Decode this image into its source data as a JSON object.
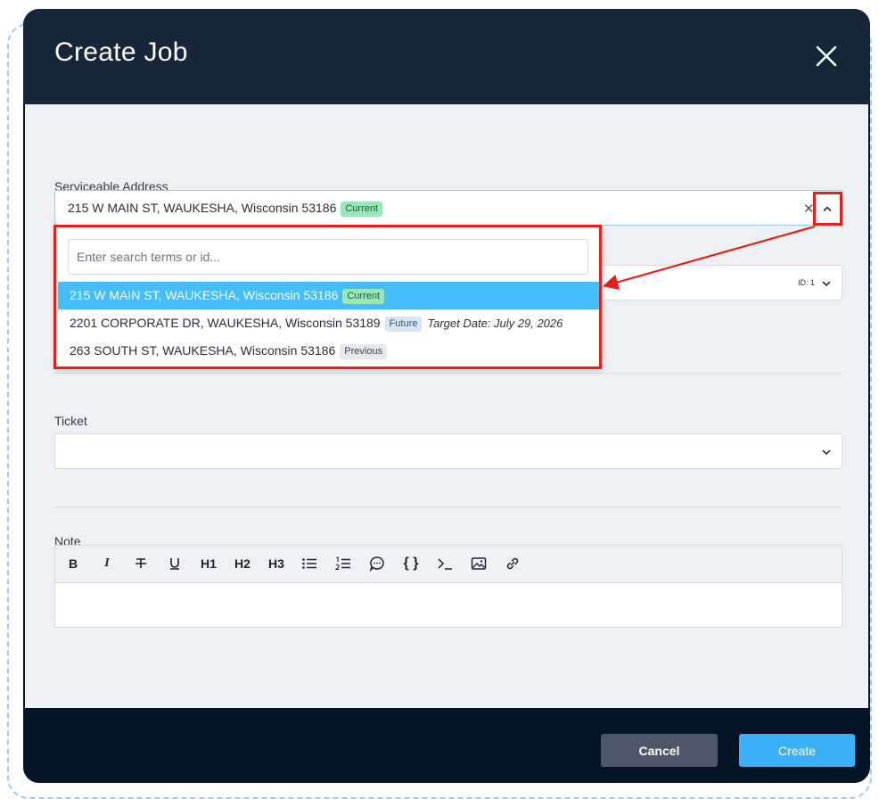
{
  "modal": {
    "title": "Create Job"
  },
  "address_field": {
    "label": "Serviceable Address",
    "selected_value": "215 W MAIN ST, WAUKESHA, Wisconsin 53186",
    "selected_badge": "Current",
    "search_placeholder": "Enter search terms or id...",
    "options": [
      {
        "text": "215 W MAIN ST, WAUKESHA, Wisconsin 53186",
        "badge": "Current",
        "extra": ""
      },
      {
        "text": "2201 CORPORATE DR, WAUKESHA, Wisconsin 53189",
        "badge": "Future",
        "extra": "Target Date: July 29, 2026"
      },
      {
        "text": "263 SOUTH ST, WAUKESHA, Wisconsin 53186",
        "badge": "Previous",
        "extra": ""
      }
    ]
  },
  "hidden_select": {
    "value": "ID: 1"
  },
  "ticket_field": {
    "label": "Ticket"
  },
  "note_field": {
    "label": "Note",
    "toolbar": {
      "bold": "B",
      "italic": "I",
      "h1": "H1",
      "h2": "H2",
      "h3": "H3",
      "code_block": "{ }"
    }
  },
  "footer": {
    "cancel_label": "Cancel",
    "create_label": "Create"
  },
  "colors": {
    "header_bg": "#172638",
    "footer_bg": "#061526",
    "body_bg": "#eef0f4",
    "selected_option": "#45bdf8",
    "primary_button": "#3bb0f7",
    "secondary_button": "#4e566a",
    "annotation_red": "#e3211c"
  }
}
